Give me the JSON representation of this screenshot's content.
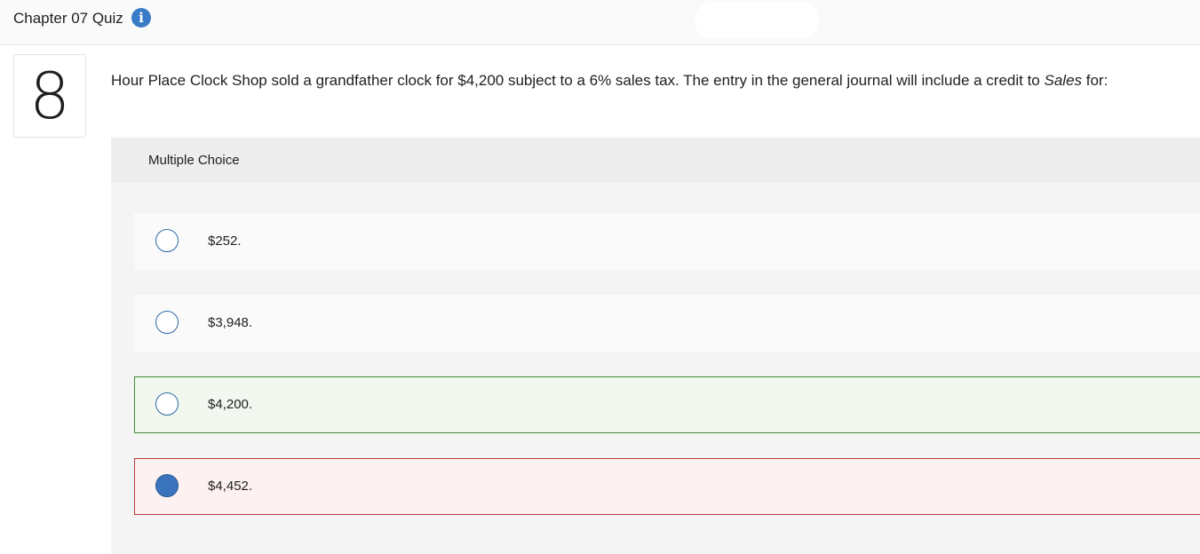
{
  "header": {
    "title": "Chapter 07 Quiz",
    "info_icon": "info-icon",
    "accent_color": "#3a7bc8"
  },
  "question": {
    "number": "8",
    "text_before": "Hour Place Clock Shop sold a grandfather clock for $4,200 subject to a 6% sales tax. The entry in the general journal will include a credit to ",
    "text_emphasis": "Sales",
    "text_after": " for:"
  },
  "multiple_choice": {
    "label": "Multiple Choice",
    "options": [
      {
        "label": "$252.",
        "state": "default",
        "selected": false
      },
      {
        "label": "$3,948.",
        "state": "default",
        "selected": false
      },
      {
        "label": "$4,200.",
        "state": "correct",
        "selected": false
      },
      {
        "label": "$4,452.",
        "state": "incorrect",
        "selected": true
      }
    ],
    "colors": {
      "correct_border": "#3e8b3a",
      "incorrect_border": "#b73a3a",
      "selected_radio": "#3a74bd"
    }
  }
}
